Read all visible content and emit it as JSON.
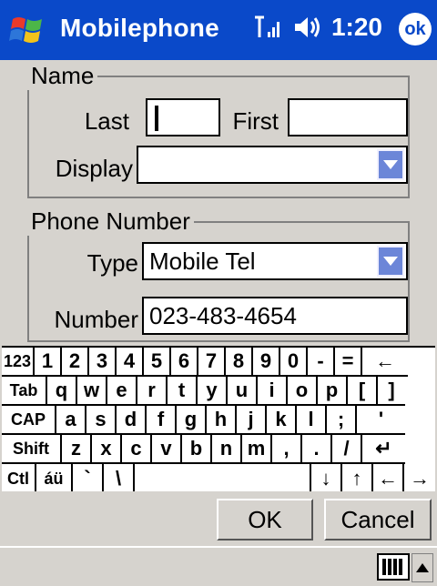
{
  "titlebar": {
    "app_title": "Mobilephone",
    "time": "1:20",
    "ok_label": "ok",
    "bg_color": "#0a49c9"
  },
  "name_group": {
    "legend": "Name",
    "last_label": "Last",
    "last_value": "",
    "first_label": "First",
    "first_value": "",
    "display_label": "Display",
    "display_value": ""
  },
  "phone_group": {
    "legend": "Phone Number",
    "type_label": "Type",
    "type_value": "Mobile Tel",
    "number_label": "Number",
    "number_value": "023-483-4654"
  },
  "keyboard": {
    "rows": [
      [
        "123",
        "1",
        "2",
        "3",
        "4",
        "5",
        "6",
        "7",
        "8",
        "9",
        "0",
        "-",
        "=",
        "←"
      ],
      [
        "Tab",
        "q",
        "w",
        "e",
        "r",
        "t",
        "y",
        "u",
        "i",
        "o",
        "p",
        "[",
        "]"
      ],
      [
        "CAP",
        "a",
        "s",
        "d",
        "f",
        "g",
        "h",
        "j",
        "k",
        "l",
        ";",
        "'"
      ],
      [
        "Shift",
        "z",
        "x",
        "c",
        "v",
        "b",
        "n",
        "m",
        ",",
        ".",
        "/",
        "↵"
      ],
      [
        "Ctl",
        "áü",
        "`",
        "\\",
        " ",
        "↓",
        "↑",
        "←",
        "→"
      ]
    ]
  },
  "buttons": {
    "ok": "OK",
    "cancel": "Cancel"
  },
  "icons": {
    "start": "windows-flag-icon",
    "signal": "signal-icon",
    "speaker": "speaker-icon",
    "input": "keyboard-icon"
  }
}
